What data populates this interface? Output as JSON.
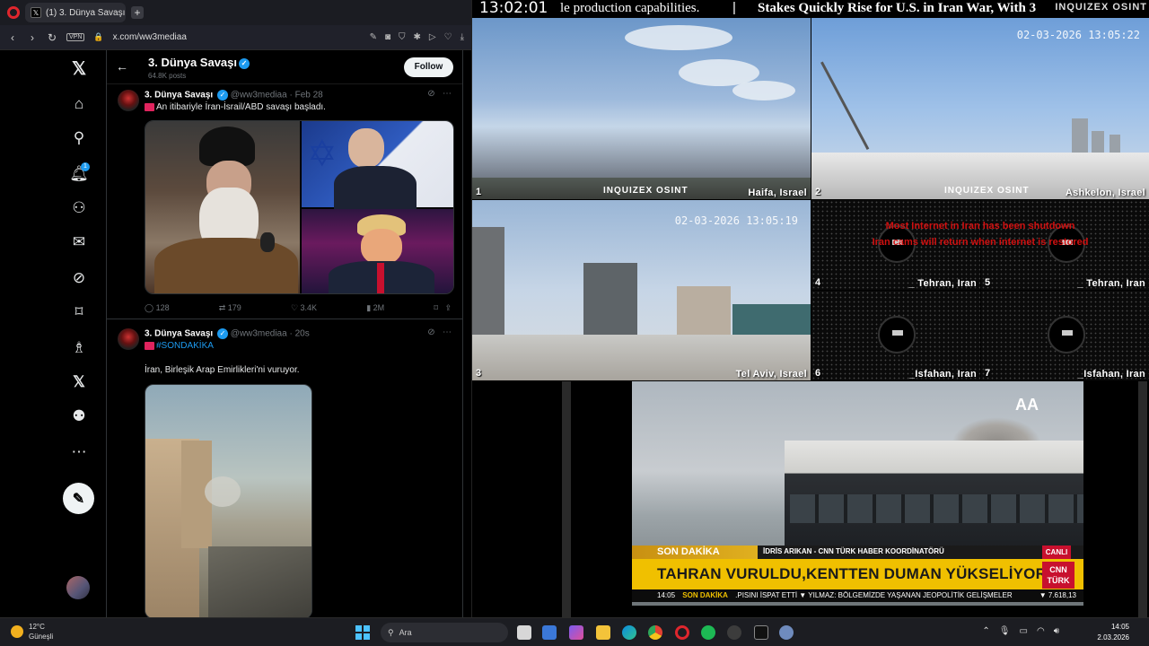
{
  "browser": {
    "tab_title": "(1) 3. Dünya Savaşı (@ww",
    "url": "x.com/ww3mediaa",
    "vpn_label": "VPN"
  },
  "x_sidebar": {
    "notif_count": "1"
  },
  "profile": {
    "name": "3. Dünya Savaşı",
    "posts": "64.8K posts",
    "follow_label": "Follow"
  },
  "tweets": [
    {
      "name": "3. Dünya Savaşı",
      "handle": "@ww3mediaa",
      "time": "Feb 28",
      "text": "An itibariyle İran-İsrail/ABD savaşı başladı.",
      "replies": "128",
      "retweets": "179",
      "likes": "3.4K",
      "views": "2M"
    },
    {
      "name": "3. Dünya Savaşı",
      "handle": "@ww3mediaa",
      "time": "20s",
      "hashtag": "#SONDAKİKA",
      "text": "İran, Birleşik Arap Emirlikleri'ni vuruyor."
    }
  ],
  "ticker": {
    "clock": "13:02:01",
    "text1": "le production capabilities.",
    "separator": "|",
    "text2": "Stakes Quickly Rise for U.S. in Iran War, With 3",
    "brand": "INQUIZEX OSINT"
  },
  "cameras": [
    {
      "num": "1",
      "location": "Haifa, Israel",
      "watermark": "INQUIZEX OSINT"
    },
    {
      "num": "2",
      "location": "Ashkelon, Israel",
      "timestamp": "02-03-2026 13:05:22",
      "watermark": "INQUIZEX OSINT"
    },
    {
      "num": "3",
      "location": "Tel Aviv, Israel",
      "timestamp": "02-03-2026 13:05:19"
    },
    {
      "num": "4",
      "location": "_ Tehran, Iran"
    },
    {
      "num": "5",
      "location": "_ Tehran, Iran"
    },
    {
      "num": "6",
      "location": "_Isfahan, Iran"
    },
    {
      "num": "7",
      "location": "_Isfahan, Iran"
    }
  ],
  "ir_message": {
    "line1": "Most Internet in Iran has been shutdown",
    "line2": "Iran cams will return when internet is restored"
  },
  "news": {
    "son_dakika": "SON DAKİKA",
    "reporter": "İDRİS ARIKAN - CNN TÜRK HABER KOORDİNATÖRÜ",
    "live": "CANLI",
    "headline": "TAHRAN VURULDU,KENTTEN DUMAN YÜKSELİYOR",
    "channel": "CNN TÜRK",
    "crawl_time": "14:05",
    "crawl_label": "SON DAKİKA",
    "crawl_text": ".PISINI İSPAT ETTİ   ▼ YILMAZ: BÖLGEMİZDE YAŞANAN JEOPOLİTİK GELİŞMELER",
    "bist": "▼ 7.618,13",
    "agency": "AA"
  },
  "taskbar": {
    "temp": "12°C",
    "weather": "Güneşli",
    "search_placeholder": "Ara",
    "time": "14:05",
    "date": "2.03.2026"
  }
}
